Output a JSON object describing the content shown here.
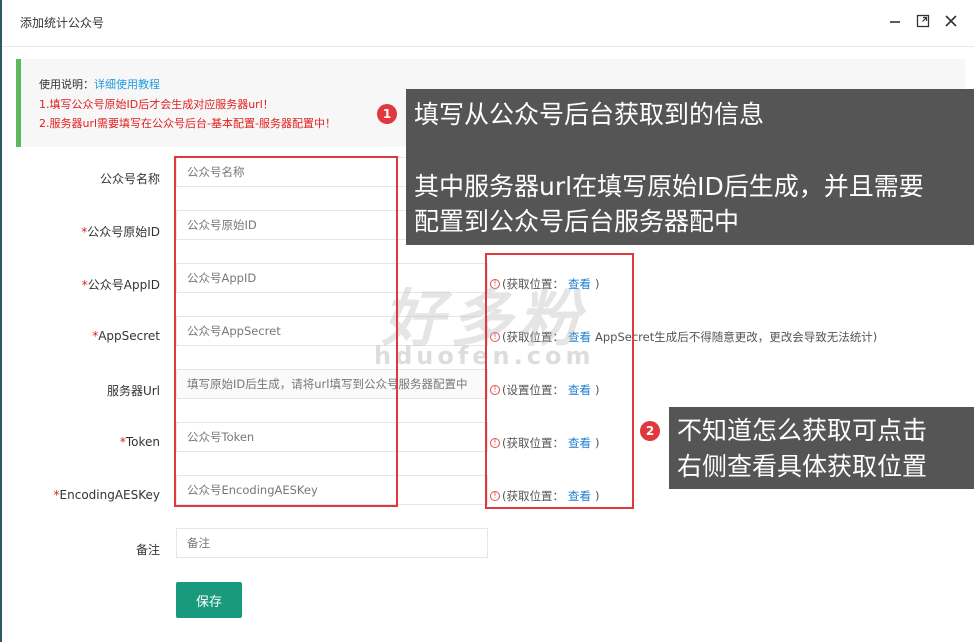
{
  "dialog": {
    "title": "添加统计公众号"
  },
  "notice": {
    "prefix": "使用说明：",
    "link": "详细使用教程",
    "line1": "1.填写公众号原始ID后才会生成对应服务器url！",
    "line2": "2.服务器url需要填写在公众号后台-基本配置-服务器配置中！"
  },
  "form": {
    "rows": [
      {
        "required": false,
        "label": "公众号名称",
        "placeholder": "公众号名称"
      },
      {
        "required": true,
        "label": "公众号原始ID",
        "placeholder": "公众号原始ID"
      },
      {
        "required": true,
        "label": "公众号AppID",
        "placeholder": "公众号AppID",
        "hint_prefix": "(获取位置：",
        "hint_link": "查看",
        "hint_suffix": ")"
      },
      {
        "required": true,
        "label": "AppSecret",
        "placeholder": "公众号AppSecret",
        "hint_prefix": "(获取位置：",
        "hint_link": "查看",
        "hint_suffix": "AppSecret生成后不得随意更改，更改会导致无法统计)"
      },
      {
        "required": false,
        "label": "服务器Url",
        "placeholder": "填写原始ID后生成，请将url填写到公众号服务器配置中",
        "hint_prefix": "(设置位置：",
        "hint_link": "查看",
        "hint_suffix": ")"
      },
      {
        "required": true,
        "label": "Token",
        "placeholder": "公众号Token",
        "hint_prefix": "(获取位置：",
        "hint_link": "查看",
        "hint_suffix": ")"
      },
      {
        "required": true,
        "label": "EncodingAESKey",
        "placeholder": "公众号EncodingAESKey",
        "hint_prefix": "(获取位置：",
        "hint_link": "查看",
        "hint_suffix": ")"
      },
      {
        "required": false,
        "label": "备注",
        "placeholder": "备注"
      }
    ],
    "save_label": "保存"
  },
  "annotations": {
    "callout1_num": "1",
    "callout1_line1": "填写从公众号后台获取到的信息",
    "callout1_line2": "其中服务器url在填写原始ID后生成，并且需要",
    "callout1_line3": "配置到公众号后台服务器配中",
    "callout2_num": "2",
    "callout2_line1": "不知道怎么获取可点击",
    "callout2_line2": "右侧查看具体获取位置"
  },
  "watermark": {
    "text": "好多粉",
    "url": "hduofen.com"
  },
  "colors": {
    "accent": "#1a9a7c",
    "notice_bar": "#5cb85c",
    "error": "#e02020",
    "link": "#1e7fd0",
    "annotation": "#e0383d"
  }
}
